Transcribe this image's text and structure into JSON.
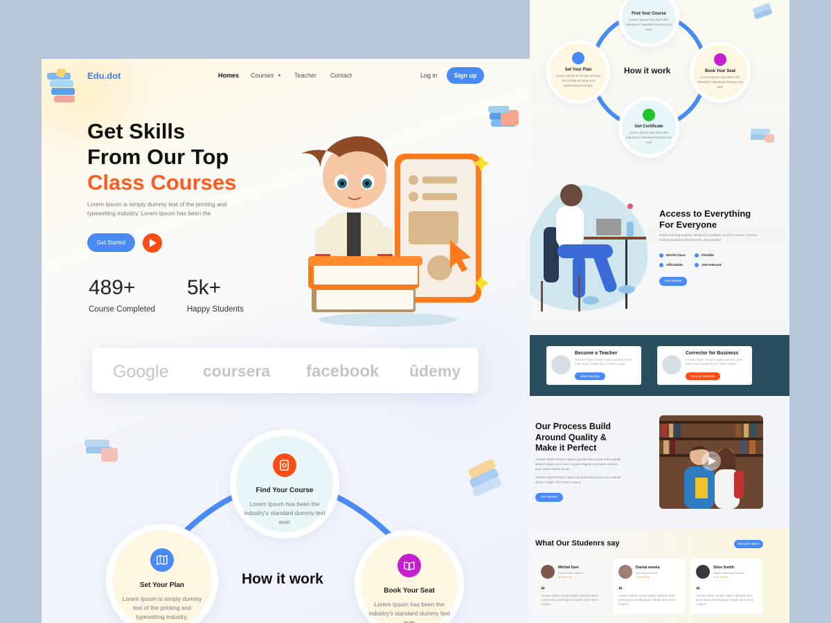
{
  "main": {
    "nav": {
      "logo": "Edu.dot",
      "links": [
        {
          "label": "Homes",
          "active": true
        },
        {
          "label": "Courses",
          "has_dropdown": true
        },
        {
          "label": "Teacher"
        },
        {
          "label": "Contact"
        }
      ],
      "login": "Log in",
      "signup": "Sign up"
    },
    "hero": {
      "title_line1": "Get Skills",
      "title_line2": "From Our Top",
      "title_highlight": "Class Courses",
      "description": "Lorem Ipsum is simply dummy text of the printing and typesetting industry. Lorem Ipsum has been the",
      "cta": "Get Started",
      "play_icon": "play-icon"
    },
    "stats": [
      {
        "value": "489+",
        "label": "Course Completed"
      },
      {
        "value": "5k+",
        "label": "Happy Students"
      }
    ],
    "brands": [
      "Google",
      "coursera",
      "facebook",
      "ûdemy"
    ],
    "how_it_work": {
      "title": "How it work",
      "steps": [
        {
          "title": "Find Your Course",
          "desc": "Lorem Ipsum has been the industry's standard dummy text ever",
          "icon": "search-doc-icon",
          "color": "#ff4d14"
        },
        {
          "title": "Set Your Plan",
          "desc": "Lorem Ipsum is simply dummy text of the printing and typesetting industry.",
          "icon": "map-icon",
          "color": "#4a8af4"
        },
        {
          "title": "Book Your Seat",
          "desc": "Lorem Ipsum has been the industry's standard dummy text ever",
          "icon": "book-icon",
          "color": "#c51ed1"
        }
      ]
    }
  },
  "side": {
    "how_it_work": {
      "title": "How it work",
      "steps": [
        {
          "title": "Find Your Course",
          "desc": "Lorem Ipsum has been the industry's standard dummy text ever",
          "color": "#ff4d14"
        },
        {
          "title": "Set Your Plan",
          "desc": "Lorem Ipsum is simply dummy text of the printing and typesetting industry.",
          "color": "#4a8af4"
        },
        {
          "title": "Book Your Seat",
          "desc": "Lorem Ipsum has been the industry's standard dummy text ever",
          "color": "#c51ed1"
        },
        {
          "title": "Get Certificate",
          "desc": "Lorem Ipsum has been the industry's standard dummy text ever",
          "color": "#22c32a"
        }
      ]
    },
    "access": {
      "title_line1": "Access to Everything",
      "title_line2": "For Everyone",
      "desc": "Online learning program designed to prepare you for a career. Courses include recorded video lectures, auto graded",
      "features": [
        "World-Class",
        "Flexible",
        "Affordable",
        "Job-relevant"
      ],
      "cta": "Get Started"
    },
    "cards": [
      {
        "title": "Become a Teacher",
        "desc": "Aenean feljam tempor sapien gravida done porta and a adodit ipsum enter congue",
        "cta": "Strat Teaching",
        "cta_color": "#4a8af4"
      },
      {
        "title": "Corrector for Business",
        "desc": "Aenean feljam tempor sapien gravida done porta and a adodit ipsum enter congue",
        "cta": "For your Business",
        "cta_color": "#ff4d14"
      }
    ],
    "process": {
      "title_line1": "Our Process Build",
      "title_line2": "Around Quality &",
      "title_line3": "Make it Perfect",
      "desc1": "Aenean feljam tempor sapien gravida done porta and a adodit ipsum integer aclor inner congue magnet and purus pretium inum quam rutrum luctus",
      "desc2": "Aenean feljam tempor sapien gravida done porta and a adodit ipsum integer actor inner congue",
      "cta": "Get Started"
    },
    "testimonials": {
      "title": "What Our Studenrs say",
      "cta": "Discover More",
      "items": [
        {
          "name": "Michal Gun",
          "role": "Word Press Student",
          "stars": "★★★★★",
          "quote": "Aenean feljam tempor sapien gravida done porta and a adodit ipsum integer actor inner congue"
        },
        {
          "name": "Danial waska",
          "role": "Branding Student",
          "stars": "★★★★★",
          "quote": "Aenean feljam tempor sapien gravida done porta and a adodit ipsum integer actor inner congue"
        },
        {
          "name": "Stive Smith",
          "role": "Digital Marketing Student",
          "stars": "★★★★★",
          "quote": "Aenean feljam tempor sapien gravida done porta and a adodit ipsum integer actor inner congue"
        }
      ]
    }
  }
}
